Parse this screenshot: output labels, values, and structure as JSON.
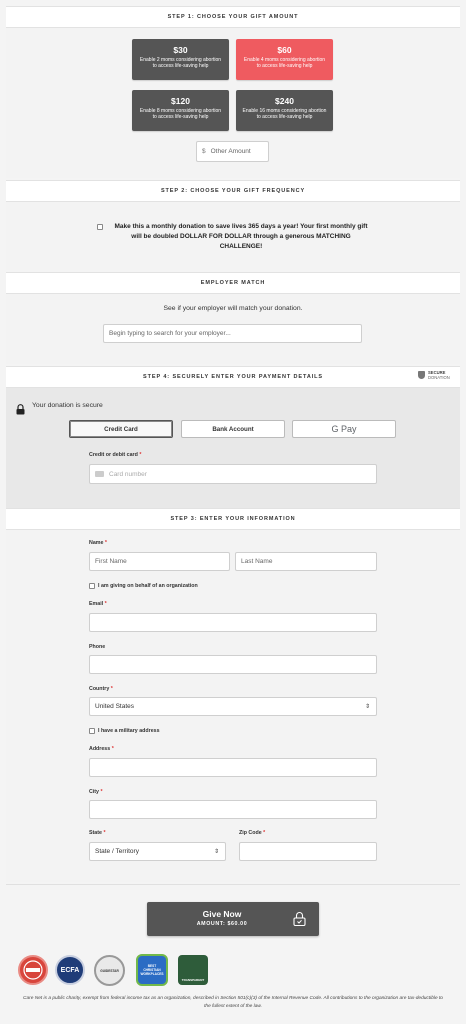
{
  "step1": {
    "header": "STEP 1: CHOOSE YOUR GIFT AMOUNT",
    "options": [
      {
        "amount": "$30",
        "desc": "Enable 2 moms considering abortion to access life-saving help"
      },
      {
        "amount": "$60",
        "desc": "Enable 4 moms considering abortion to access life-saving help"
      },
      {
        "amount": "$120",
        "desc": "Enable 8 moms considering abortion to access life-saving help"
      },
      {
        "amount": "$240",
        "desc": "Enable 16 moms considering abortion to access life-saving help"
      }
    ],
    "other_symbol": "$",
    "other_placeholder": "Other Amount"
  },
  "step2": {
    "header": "STEP 2: CHOOSE YOUR GIFT FREQUENCY",
    "monthly_text": "Make this a monthly donation to save lives 365 days a year! Your first monthly gift will be doubled DOLLAR FOR DOLLAR through a generous MATCHING CHALLENGE!"
  },
  "employer": {
    "header": "EMPLOYER MATCH",
    "prompt": "See if your employer will match your donation.",
    "placeholder": "Begin typing to search for your employer..."
  },
  "step4": {
    "header": "STEP 4: SECURELY ENTER YOUR PAYMENT DETAILS",
    "secure_badge_top": "SECURE",
    "secure_badge_bottom": "DONATION",
    "secure_note": "Your donation is secure",
    "tabs": [
      "Credit Card",
      "Bank Account",
      "G Pay"
    ],
    "card_label": "Credit or debit card",
    "card_placeholder": "Card number"
  },
  "step3": {
    "header": "STEP 3: ENTER YOUR INFORMATION",
    "name_label": "Name",
    "first_placeholder": "First Name",
    "last_placeholder": "Last Name",
    "org_label": "I am giving on behalf of an organization",
    "email_label": "Email",
    "phone_label": "Phone",
    "country_label": "Country",
    "country_value": "United States",
    "military_label": "I have a military address",
    "address_label": "Address",
    "city_label": "City",
    "state_label": "State",
    "state_value": "State / Territory",
    "zip_label": "Zip Code",
    "required_mark": "*"
  },
  "submit": {
    "label": "Give Now",
    "amount": "AMOUNT: $60.00"
  },
  "badges": [
    "ECFA",
    "GUIDESTAR",
    "BEST CHRISTIAN WORKPLACES",
    "TRANSPARENT"
  ],
  "footer": "Care Net is a public charity, exempt from federal income tax as an organization, described in Section 501(c)(3) of the Internal Revenue Code. All contributions to the organization are tax-deductible to the fullest extent of the law.",
  "colors": {
    "accent": "#ef5b60",
    "button": "#555555"
  }
}
